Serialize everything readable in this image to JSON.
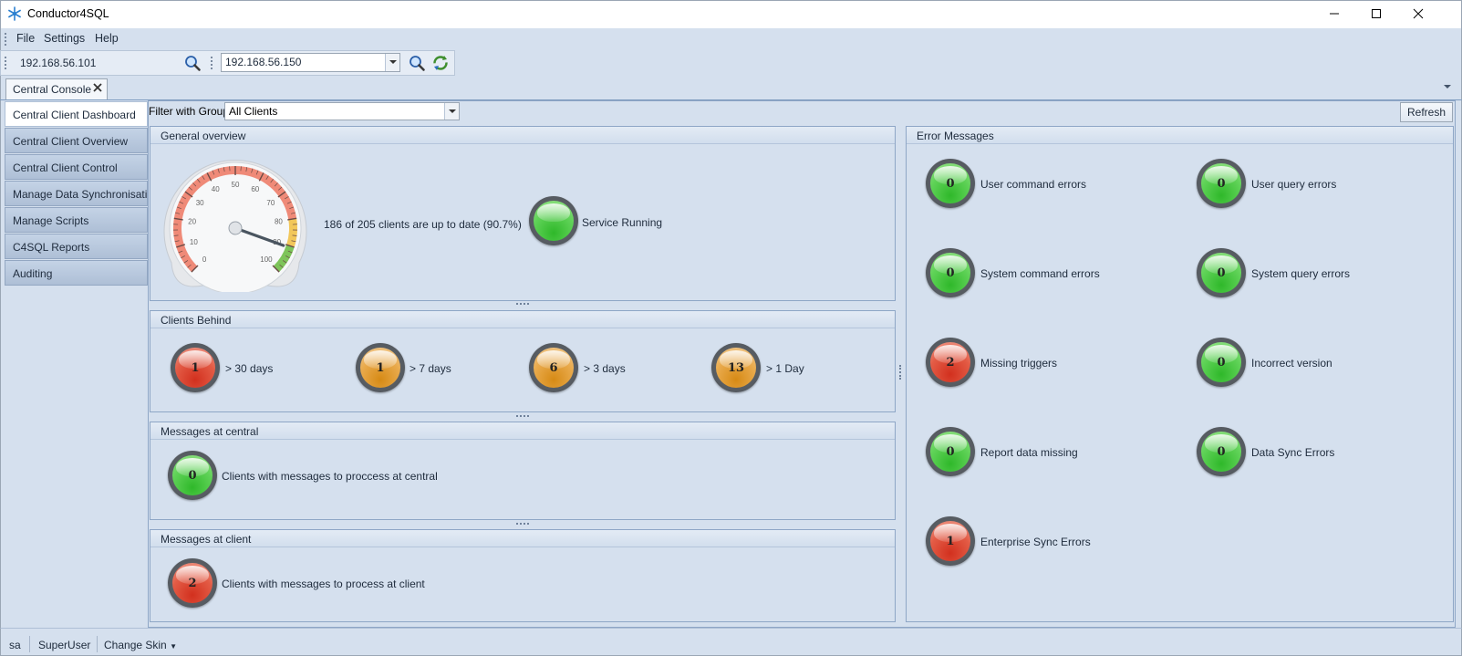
{
  "window": {
    "title": "Conductor4SQL",
    "controls": {
      "minimize": "minimize-icon",
      "maximize": "maximize-icon",
      "close": "close-icon"
    }
  },
  "menu": {
    "items": [
      "File",
      "Settings",
      "Help"
    ]
  },
  "toolbar": {
    "left_server": "192.168.56.101",
    "right_server": "192.168.56.150"
  },
  "document_tab": {
    "label": "Central Console"
  },
  "sidebar": {
    "items": [
      {
        "label": "Central Client Dashboard",
        "active": true
      },
      {
        "label": "Central Client Overview"
      },
      {
        "label": "Central Client Control"
      },
      {
        "label": "Manage Data Synchronisation"
      },
      {
        "label": "Manage Scripts"
      },
      {
        "label": "C4SQL Reports"
      },
      {
        "label": "Auditing"
      }
    ]
  },
  "filter": {
    "label": "Filter with Group",
    "value": "All Clients"
  },
  "refresh_label": "Refresh",
  "general_overview": {
    "title": "General overview",
    "gauge": {
      "value": 90.7,
      "min": 0,
      "max": 100,
      "ticks": [
        "0",
        "10",
        "20",
        "30",
        "40",
        "50",
        "60",
        "70",
        "80",
        "90",
        "100"
      ]
    },
    "status_text": "186 of 205 clients are up to date (90.7%)",
    "service": {
      "label": "Service Running",
      "color": "green"
    }
  },
  "clients_behind": {
    "title": "Clients Behind",
    "items": [
      {
        "count": "1",
        "label": "> 30 days",
        "color": "red"
      },
      {
        "count": "1",
        "label": "> 7 days",
        "color": "orange"
      },
      {
        "count": "6",
        "label": "> 3 days",
        "color": "orange"
      },
      {
        "count": "13",
        "label": "> 1 Day",
        "color": "orange"
      }
    ]
  },
  "messages_central": {
    "title": "Messages at central",
    "count": "0",
    "label": "Clients with messages to proccess at central",
    "color": "green"
  },
  "messages_client": {
    "title": "Messages at client",
    "count": "2",
    "label": "Clients with messages to process at client",
    "color": "red"
  },
  "error_messages": {
    "title": "Error Messages",
    "items": [
      {
        "count": "0",
        "label": "User command errors",
        "color": "green"
      },
      {
        "count": "0",
        "label": "User query errors",
        "color": "green"
      },
      {
        "count": "0",
        "label": "System command errors",
        "color": "green"
      },
      {
        "count": "0",
        "label": "System query errors",
        "color": "green"
      },
      {
        "count": "2",
        "label": "Missing triggers",
        "color": "red"
      },
      {
        "count": "0",
        "label": "Incorrect version",
        "color": "green"
      },
      {
        "count": "0",
        "label": "Report data missing",
        "color": "green"
      },
      {
        "count": "0",
        "label": "Data Sync Errors",
        "color": "green"
      },
      {
        "count": "1",
        "label": "Enterprise Sync Errors",
        "color": "red"
      }
    ]
  },
  "statusbar": {
    "user": "sa",
    "role": "SuperUser",
    "skin": "Change Skin"
  },
  "colors": {
    "chrome": "#d5e0ee",
    "border": "#8ea6c6",
    "nav": "#aebfd6"
  }
}
